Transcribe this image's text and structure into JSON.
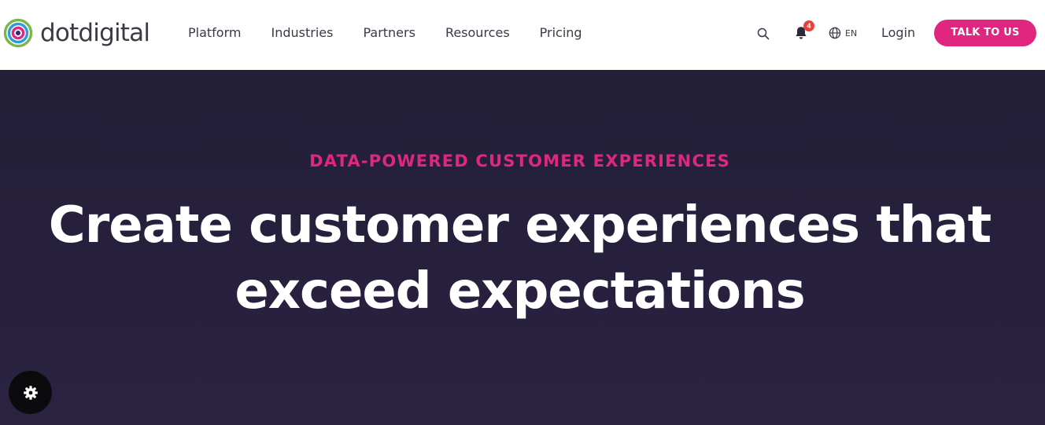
{
  "brand": {
    "name": "dotdigital",
    "logo_icon": "concentric-rings-logo",
    "colors": {
      "ring_outer": "#7ab648",
      "ring_middle": "#2d9cdb",
      "ring_inner": "#e0267f",
      "ring_core": "#2b2a6e"
    }
  },
  "nav": {
    "items": [
      "Platform",
      "Industries",
      "Partners",
      "Resources",
      "Pricing"
    ]
  },
  "header_actions": {
    "search_icon": "search-icon",
    "notifications_icon": "bell-icon",
    "notifications_count": "4",
    "language_icon": "globe-icon",
    "language": "EN",
    "login_label": "Login",
    "cta_label": "TALK TO US"
  },
  "hero": {
    "eyebrow": "DATA-POWERED CUSTOMER EXPERIENCES",
    "title_line1": "Create customer experiences that",
    "title_line2": "exceed expectations"
  },
  "settings_fab": {
    "icon": "gear-icon"
  },
  "theme": {
    "accent": "#e0267f",
    "hero_background": "#251f3b",
    "text_dark": "#3a3a46",
    "badge": "#e8413b"
  }
}
